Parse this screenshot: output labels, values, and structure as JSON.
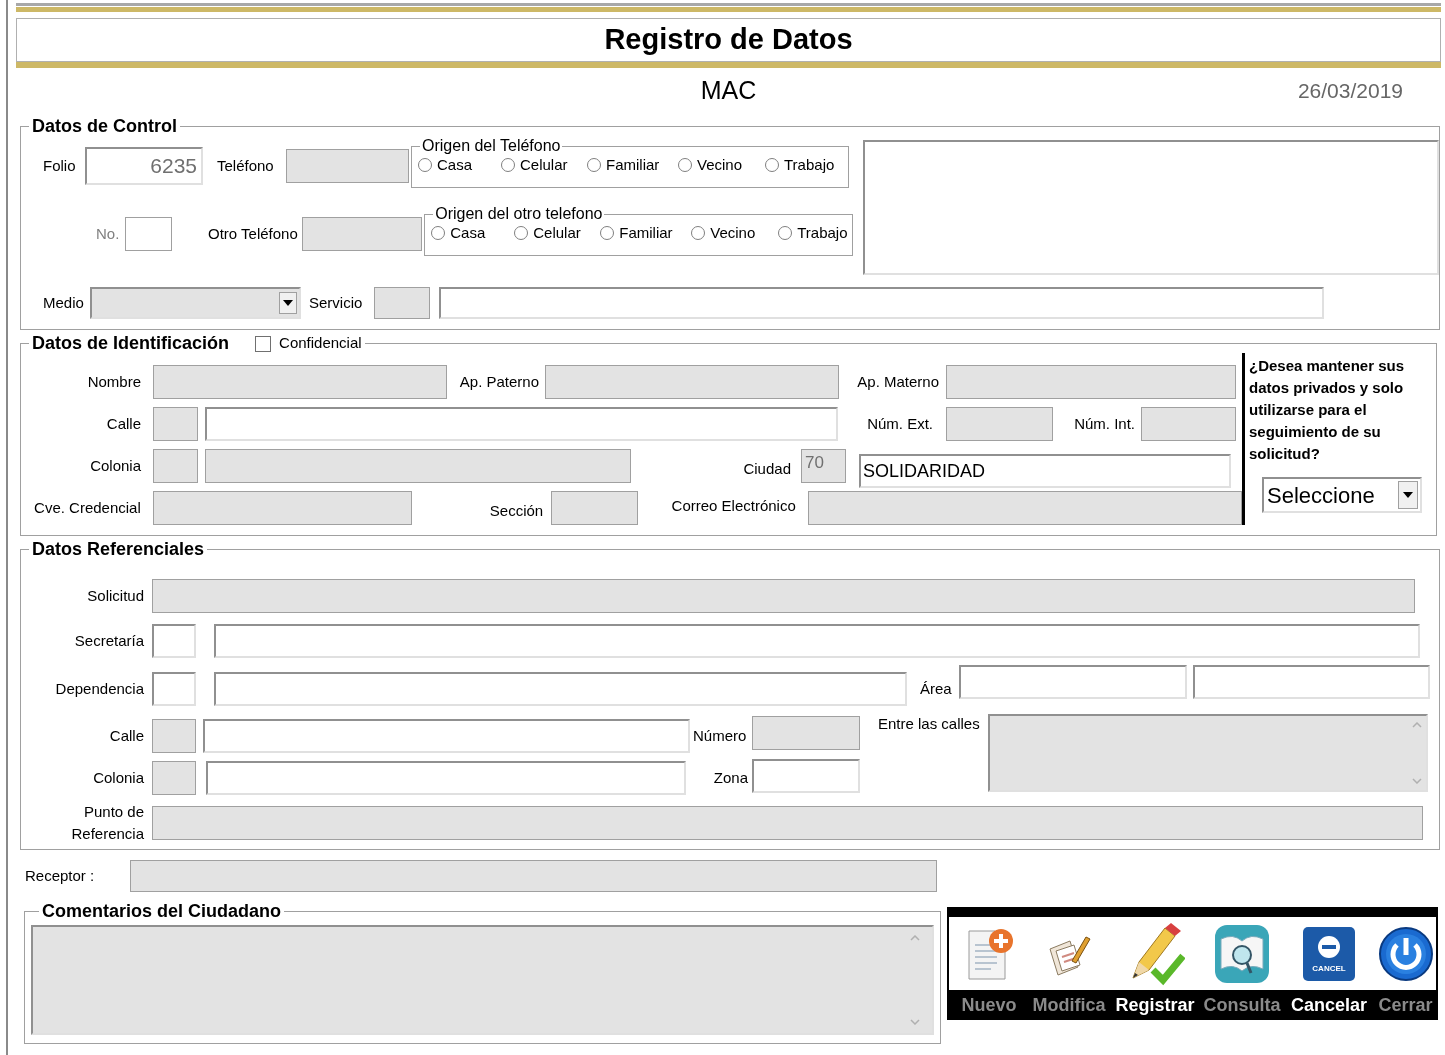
{
  "title": "Registro de Datos",
  "office": "MAC",
  "date": "26/03/2019",
  "control": {
    "legend": "Datos de Control",
    "folio": {
      "label": "Folio",
      "value": "6235",
      "disabled": false
    },
    "telefono": {
      "label": "Teléfono",
      "disabled": true
    },
    "origen_telefono": {
      "legend": "Origen del Teléfono",
      "options": [
        {
          "label": "Casa",
          "selected": false
        },
        {
          "label": "Celular",
          "selected": false
        },
        {
          "label": "Familiar",
          "selected": false
        },
        {
          "label": "Vecino",
          "selected": false
        },
        {
          "label": "Trabajo",
          "selected": false
        }
      ]
    },
    "no": {
      "label": "No.",
      "disabled": false
    },
    "otro_telefono": {
      "label": "Otro Teléfono",
      "disabled": true
    },
    "origen_otro_telefono": {
      "legend": "Origen del otro telefono",
      "options": [
        {
          "label": "Casa",
          "selected": false
        },
        {
          "label": "Celular",
          "selected": false
        },
        {
          "label": "Familiar",
          "selected": false
        },
        {
          "label": "Vecino",
          "selected": false
        },
        {
          "label": "Trabajo",
          "selected": false
        }
      ]
    },
    "notes": {
      "disabled": false
    },
    "medio": {
      "label": "Medio",
      "disabled": true
    },
    "servicio": {
      "label": "Servicio",
      "disabled": true
    },
    "servicio_descripcion": {
      "disabled": false
    }
  },
  "identificacion": {
    "legend": "Datos de Identificación",
    "confidencial": {
      "label": "Confidencial",
      "checked": false
    },
    "nombre": {
      "label": "Nombre",
      "disabled": true
    },
    "ap_paterno": {
      "label": "Ap. Paterno",
      "disabled": true
    },
    "ap_materno": {
      "label": "Ap. Materno",
      "disabled": true
    },
    "calle_clave": {
      "label": "Calle",
      "disabled": true
    },
    "calle_nombre": {
      "disabled": false
    },
    "num_ext": {
      "label": "Núm. Ext.",
      "disabled": true
    },
    "num_int": {
      "label": "Núm. Int.",
      "disabled": true
    },
    "colonia_clave": {
      "label": "Colonia",
      "disabled": true
    },
    "colonia_nombre": {
      "disabled": true
    },
    "ciudad_clave": {
      "label": "Ciudad",
      "value": "70",
      "disabled": true
    },
    "ciudad_nombre": {
      "value": "SOLIDARIDAD",
      "disabled": false
    },
    "cve_credencial": {
      "label": "Cve. Credencial",
      "disabled": true
    },
    "seccion": {
      "label": "Sección",
      "disabled": true
    },
    "correo": {
      "label": "Correo Electrónico",
      "disabled": true
    },
    "privacidad": {
      "question": "¿Desea mantener sus datos privados y solo utilizarse para el seguimiento de su solicitud?",
      "value": "Seleccione",
      "disabled": false
    }
  },
  "referenciales": {
    "legend": "Datos Referenciales",
    "solicitud": {
      "label": "Solicitud",
      "disabled": true
    },
    "secretaria_clave": {
      "label": "Secretaría",
      "disabled": false
    },
    "secretaria_nombre": {
      "disabled": false
    },
    "dependencia_clave": {
      "label": "Dependencia",
      "disabled": false
    },
    "dependencia_nombre": {
      "disabled": false
    },
    "area_1": {
      "label": "Área",
      "disabled": false
    },
    "area_2": {
      "disabled": false
    },
    "calle_clave": {
      "label": "Calle",
      "disabled": true
    },
    "calle_nombre": {
      "disabled": false
    },
    "numero": {
      "label": "Número",
      "disabled": true
    },
    "entre_calles": {
      "label": "Entre las calles",
      "disabled": true
    },
    "colonia_clave": {
      "label": "Colonia",
      "disabled": true
    },
    "colonia_nombre": {
      "disabled": false
    },
    "zona": {
      "label": "Zona",
      "disabled": false
    },
    "punto_referencia": {
      "label": "Punto de Referencia",
      "disabled": true
    }
  },
  "receptor": {
    "label": "Receptor :",
    "disabled": true
  },
  "comentarios": {
    "legend": "Comentarios del Ciudadano",
    "disabled": true
  },
  "toolbar": {
    "buttons": [
      {
        "label": "Nuevo",
        "disabled": true
      },
      {
        "label": "Modifica",
        "disabled": true
      },
      {
        "label": "Registrar",
        "disabled": false
      },
      {
        "label": "Consulta",
        "disabled": true
      },
      {
        "label": "Cancelar",
        "disabled": false,
        "badge": "CANCEL"
      },
      {
        "label": "Cerrar",
        "disabled": true
      }
    ]
  }
}
